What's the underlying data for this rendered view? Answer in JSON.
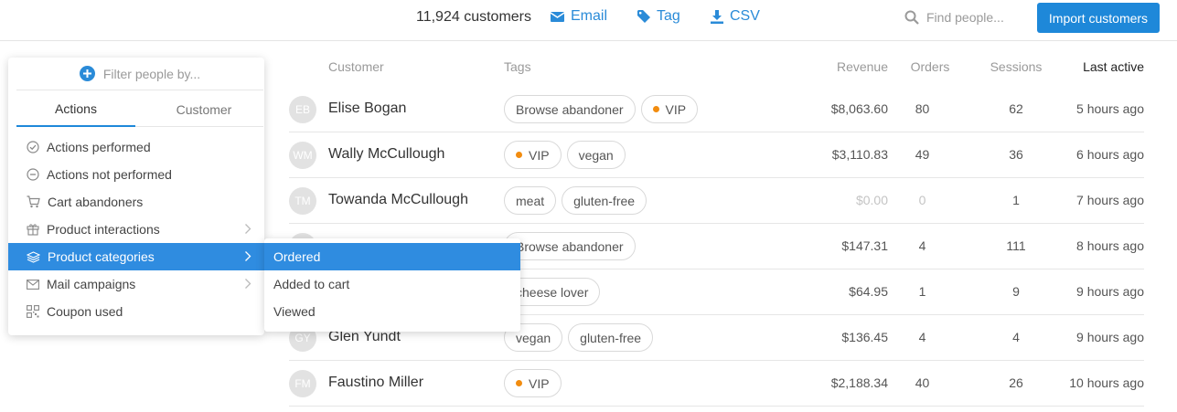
{
  "header": {
    "customer_count": "11,924 customers",
    "email_label": "Email",
    "tag_label": "Tag",
    "csv_label": "CSV",
    "search_placeholder": "Find people...",
    "import_label": "Import customers"
  },
  "table": {
    "columns": [
      "Customer",
      "Tags",
      "Revenue",
      "Orders",
      "Sessions",
      "Last active"
    ],
    "rows": [
      {
        "initials": "EB",
        "name": "Elise Bogan",
        "tags": [
          {
            "label": "Browse abandoner",
            "dot": false
          },
          {
            "label": "VIP",
            "dot": true
          }
        ],
        "revenue": "$8,063.60",
        "orders": "80",
        "sessions": "62",
        "last_active": "5 hours ago"
      },
      {
        "initials": "WM",
        "name": "Wally McCullough",
        "tags": [
          {
            "label": "VIP",
            "dot": true
          },
          {
            "label": "vegan",
            "dot": false
          }
        ],
        "revenue": "$3,110.83",
        "orders": "49",
        "sessions": "36",
        "last_active": "6 hours ago"
      },
      {
        "initials": "TM",
        "name": "Towanda McCullough",
        "tags": [
          {
            "label": "meat",
            "dot": false
          },
          {
            "label": "gluten-free",
            "dot": false
          }
        ],
        "revenue": "$0.00",
        "orders": "0",
        "sessions": "1",
        "last_active": "7 hours ago",
        "muted": true
      },
      {
        "initials": "",
        "name": "",
        "tags": [
          {
            "label": "Browse abandoner",
            "dot": false
          }
        ],
        "revenue": "$147.31",
        "orders": "4",
        "sessions": "111",
        "last_active": "8 hours ago"
      },
      {
        "initials": "",
        "name": "",
        "tags": [
          {
            "label": "cheese lover",
            "dot": false
          }
        ],
        "revenue": "$64.95",
        "orders": "1",
        "sessions": "9",
        "last_active": "9 hours ago"
      },
      {
        "initials": "GY",
        "name": "Glen Yundt",
        "tags": [
          {
            "label": "vegan",
            "dot": false
          },
          {
            "label": "gluten-free",
            "dot": false
          }
        ],
        "revenue": "$136.45",
        "orders": "4",
        "sessions": "4",
        "last_active": "9 hours ago"
      },
      {
        "initials": "FM",
        "name": "Faustino Miller",
        "tags": [
          {
            "label": "VIP",
            "dot": true
          }
        ],
        "revenue": "$2,188.34",
        "orders": "40",
        "sessions": "26",
        "last_active": "10 hours ago"
      }
    ]
  },
  "filter": {
    "header": "Filter people by...",
    "tabs": [
      "Actions",
      "Customer"
    ],
    "items": [
      {
        "label": "Actions performed",
        "icon": "check-circle-icon",
        "submenu": false
      },
      {
        "label": "Actions not performed",
        "icon": "minus-circle-icon",
        "submenu": false
      },
      {
        "label": "Cart abandoners",
        "icon": "cart-icon",
        "submenu": false
      },
      {
        "label": "Product interactions",
        "icon": "gift-icon",
        "submenu": true
      },
      {
        "label": "Product categories",
        "icon": "layers-icon",
        "submenu": true,
        "active": true
      },
      {
        "label": "Mail campaigns",
        "icon": "envelope-icon",
        "submenu": true
      },
      {
        "label": "Coupon used",
        "icon": "qr-code-icon",
        "submenu": false
      }
    ]
  },
  "submenu": {
    "items": [
      "Ordered",
      "Added to cart",
      "Viewed"
    ]
  },
  "colors": {
    "accent": "#1e88d9",
    "active_row": "#2f8ce0",
    "vip_dot": "#f28c0f"
  }
}
